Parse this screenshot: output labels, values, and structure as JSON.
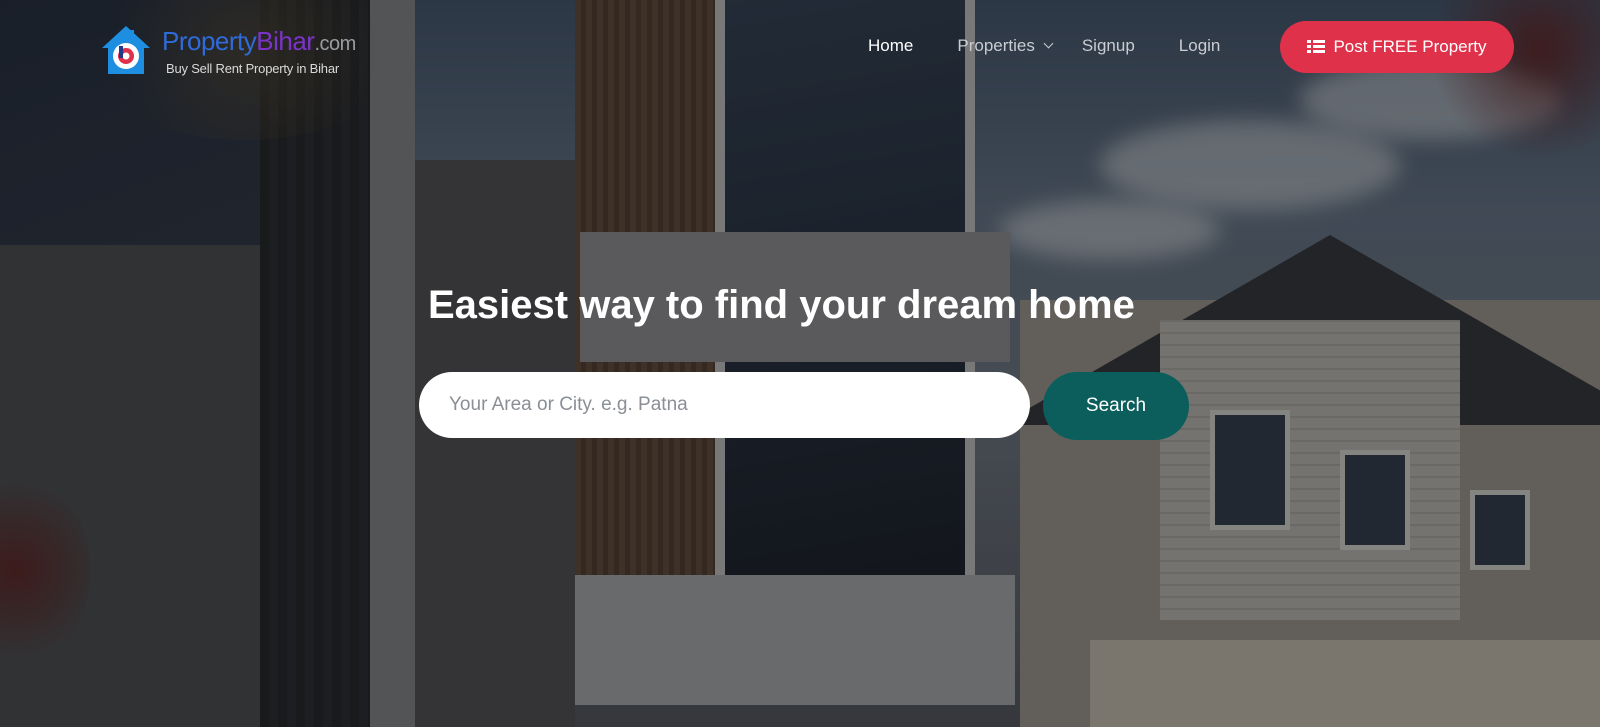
{
  "brand": {
    "name_part1": "Property",
    "name_part2": "Bihar",
    "name_suffix": ".com",
    "tagline": "Buy Sell Rent Property in Bihar",
    "colors": {
      "primary": "#2f6bd8",
      "secondary": "#7b34c9"
    }
  },
  "nav": {
    "items": [
      {
        "label": "Home",
        "active": true
      },
      {
        "label": "Properties",
        "has_dropdown": true
      },
      {
        "label": "Signup"
      },
      {
        "label": "Login"
      }
    ],
    "post_button_label": "Post FREE Property",
    "post_button_icon": "list-icon",
    "post_button_color": "#e0314a"
  },
  "hero": {
    "headline": "Easiest way to find your dream home",
    "search": {
      "placeholder": "Your Area or City. e.g. Patna",
      "value": "",
      "button_label": "Search",
      "button_color": "#0c5e5c"
    }
  }
}
